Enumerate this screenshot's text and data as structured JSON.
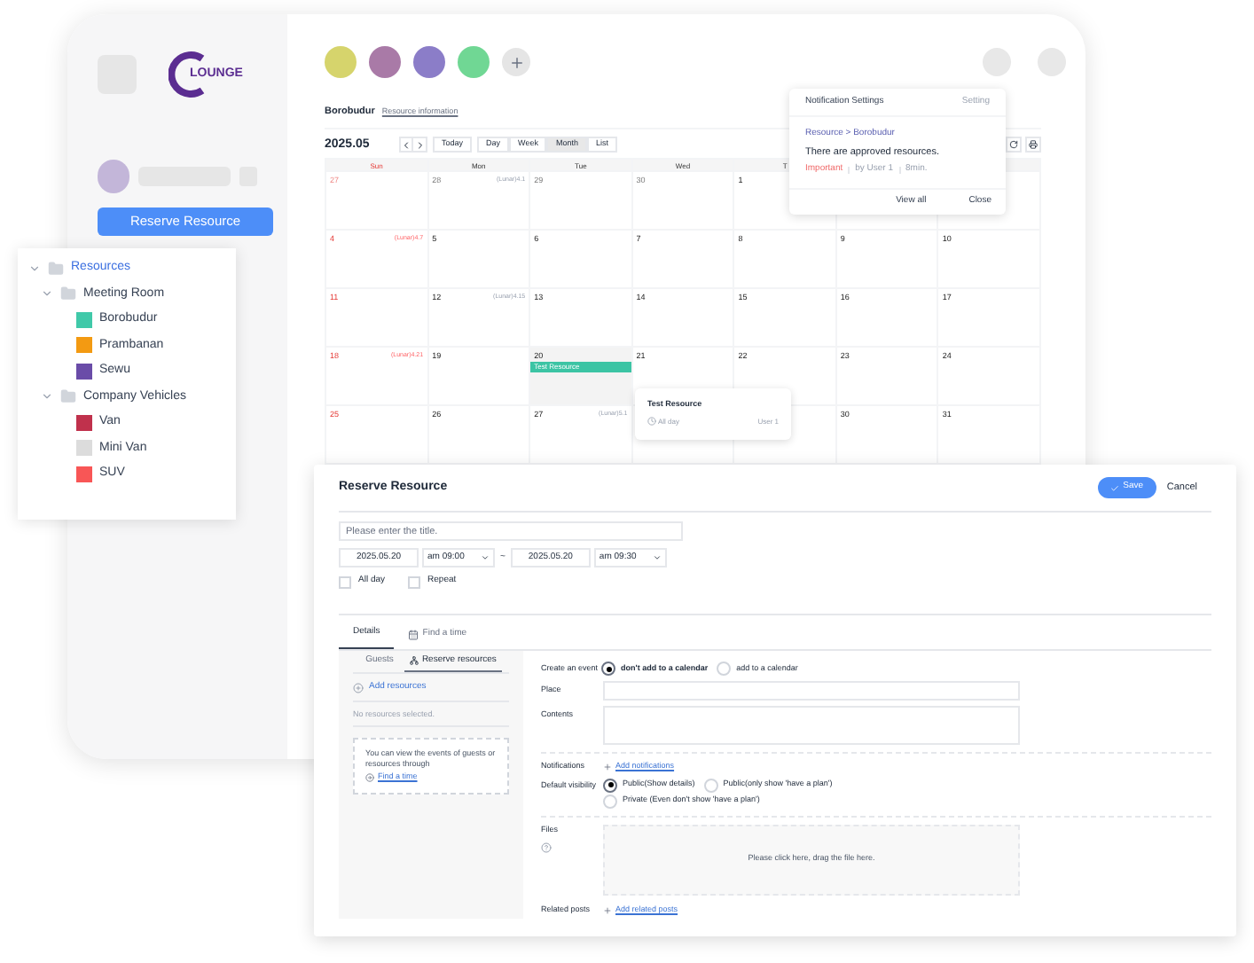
{
  "app": {
    "logo": "LOUNGE",
    "reserve_button": "Reserve Resource"
  },
  "color_filters": [
    {
      "color": "#d6d46c"
    },
    {
      "color": "#a97aa7"
    },
    {
      "color": "#8b7dc8"
    },
    {
      "color": "#70d794"
    }
  ],
  "calendar": {
    "resource": "Borobudur",
    "info_link": "Resource information",
    "month": "2025.05",
    "today": "Today",
    "views": [
      {
        "label": "Day",
        "selected": false
      },
      {
        "label": "Week",
        "selected": false
      },
      {
        "label": "Month",
        "selected": true
      },
      {
        "label": "List",
        "selected": false
      }
    ],
    "weekdays": [
      {
        "label": "Sun",
        "holiday": true
      },
      {
        "label": "Mon",
        "holiday": false
      },
      {
        "label": "Tue",
        "holiday": false
      },
      {
        "label": "Wed",
        "holiday": false
      },
      {
        "label": "T",
        "holiday": false
      }
    ],
    "weeks": [
      [
        {
          "date": "27",
          "other_month": true,
          "holiday": true,
          "selected": false
        },
        {
          "date": "28",
          "other_month": true,
          "holiday": false,
          "selected": false,
          "lunar": "(Lunar)4.1"
        },
        {
          "date": "29",
          "other_month": true,
          "holiday": false,
          "selected": false
        },
        {
          "date": "30",
          "other_month": true,
          "holiday": false,
          "selected": false
        },
        {
          "date": "1",
          "other_month": false,
          "holiday": false,
          "selected": false
        },
        {
          "selected": false
        },
        {
          "selected": false
        }
      ],
      [
        {
          "date": "4",
          "other_month": false,
          "holiday": true,
          "selected": false,
          "lunar": "(Lunar)4.7"
        },
        {
          "date": "5",
          "other_month": false,
          "holiday": false,
          "selected": false
        },
        {
          "date": "6",
          "other_month": false,
          "holiday": false,
          "selected": false
        },
        {
          "date": "7",
          "other_month": false,
          "holiday": false,
          "selected": false
        },
        {
          "date": "8",
          "other_month": false,
          "holiday": false,
          "selected": false
        },
        {
          "date": "9",
          "other_month": false,
          "holiday": false,
          "selected": false
        },
        {
          "date": "10",
          "other_month": false,
          "holiday": false,
          "selected": false
        }
      ],
      [
        {
          "date": "11",
          "other_month": false,
          "holiday": true,
          "selected": false
        },
        {
          "date": "12",
          "other_month": false,
          "holiday": false,
          "selected": false,
          "lunar": "(Lunar)4.15"
        },
        {
          "date": "13",
          "other_month": false,
          "holiday": false,
          "selected": false
        },
        {
          "date": "14",
          "other_month": false,
          "holiday": false,
          "selected": false
        },
        {
          "date": "15",
          "other_month": false,
          "holiday": false,
          "selected": false
        },
        {
          "date": "16",
          "other_month": false,
          "holiday": false,
          "selected": false
        },
        {
          "date": "17",
          "other_month": false,
          "holiday": false,
          "selected": false
        }
      ],
      [
        {
          "date": "18",
          "other_month": false,
          "holiday": true,
          "selected": false,
          "lunar": "(Lunar)4.21"
        },
        {
          "date": "19",
          "other_month": false,
          "holiday": false,
          "selected": false
        },
        {
          "date": "20",
          "other_month": false,
          "holiday": false,
          "selected": true,
          "events": [
            {
              "title": "Test Resource",
              "color": "#3cc4a4"
            }
          ]
        },
        {
          "date": "21",
          "other_month": false,
          "holiday": false,
          "selected": false
        },
        {
          "date": "22",
          "other_month": false,
          "holiday": false,
          "selected": false
        },
        {
          "date": "23",
          "other_month": false,
          "holiday": false,
          "selected": false
        },
        {
          "date": "24",
          "other_month": false,
          "holiday": false,
          "selected": false
        }
      ],
      [
        {
          "date": "25",
          "other_month": false,
          "holiday": true,
          "selected": false
        },
        {
          "date": "26",
          "other_month": false,
          "holiday": false,
          "selected": false
        },
        {
          "date": "27",
          "other_month": false,
          "holiday": false,
          "selected": false,
          "lunar": "(Lunar)5.1"
        },
        {
          "selected": false
        },
        {
          "selected": false
        },
        {
          "date": "30",
          "other_month": false,
          "holiday": false,
          "selected": false
        },
        {
          "date": "31",
          "other_month": false,
          "holiday": false,
          "selected": false
        }
      ]
    ]
  },
  "notification": {
    "title": "Notification Settings",
    "setting": "Setting",
    "path": "Resource > Borobudur",
    "message": "There are approved resources.",
    "tag": "Important",
    "author": "by User 1",
    "time": "8min.",
    "actions": [
      "View all",
      "Close"
    ]
  },
  "event_popover": {
    "title": "Test Resource",
    "time": "All day",
    "user": "User 1"
  },
  "tree": [
    {
      "label": "Resources",
      "expanded": true,
      "children": [
        {
          "label": "Meeting Room",
          "expanded": true,
          "children": [
            {
              "label": "Borobudur",
              "color": "#40c9a9"
            },
            {
              "label": "Prambanan",
              "color": "#f39a12"
            },
            {
              "label": "Sewu",
              "color": "#6a4ca8"
            }
          ]
        },
        {
          "label": "Company Vehicles",
          "expanded": true,
          "children": [
            {
              "label": "Van",
              "color": "#c0314c"
            },
            {
              "label": "Mini Van",
              "color": "#dcdcdc"
            },
            {
              "label": "SUV",
              "color": "#f85656"
            }
          ]
        }
      ]
    }
  ],
  "form": {
    "title": "Reserve Resource",
    "save": "Save",
    "cancel": "Cancel",
    "title_placeholder": "Please enter the title.",
    "start_date": "2025.05.20",
    "start_time": "am 09:00",
    "separator": "~",
    "end_date": "2025.05.20",
    "end_time": "am 09:30",
    "options": [
      {
        "label": "All day",
        "checked": false
      },
      {
        "label": "Repeat",
        "checked": false
      }
    ],
    "tabs": [
      {
        "label": "Details",
        "selected": true
      },
      {
        "label": "Find a time",
        "selected": false
      }
    ],
    "side_tabs": [
      {
        "label": "Guests",
        "selected": false
      },
      {
        "label": "Reserve resources",
        "selected": true
      }
    ],
    "add_resources": "Add resources",
    "empty": "No resources selected.",
    "hint": "You can view the events of guests or resources through",
    "hint_link": "Find a time",
    "create_event": {
      "label": "Create an event",
      "options": [
        {
          "label": "don't add to a calendar",
          "selected": true
        },
        {
          "label": "add to a calendar",
          "selected": false
        }
      ]
    },
    "place": {
      "label": "Place"
    },
    "contents": {
      "label": "Contents"
    },
    "notifications": {
      "label": "Notifications",
      "link": "Add notifications"
    },
    "visibility": {
      "label": "Default visibility",
      "options": [
        {
          "label": "Public(Show details)",
          "selected": true
        },
        {
          "label": "Public(only show 'have a plan')",
          "selected": false
        },
        {
          "label": "Private (Even don't show 'have a plan')",
          "selected": false
        }
      ]
    },
    "files": {
      "label": "Files",
      "dropzone": "Please click here, drag the file here."
    },
    "related": {
      "label": "Related posts",
      "link": "Add related posts"
    }
  }
}
